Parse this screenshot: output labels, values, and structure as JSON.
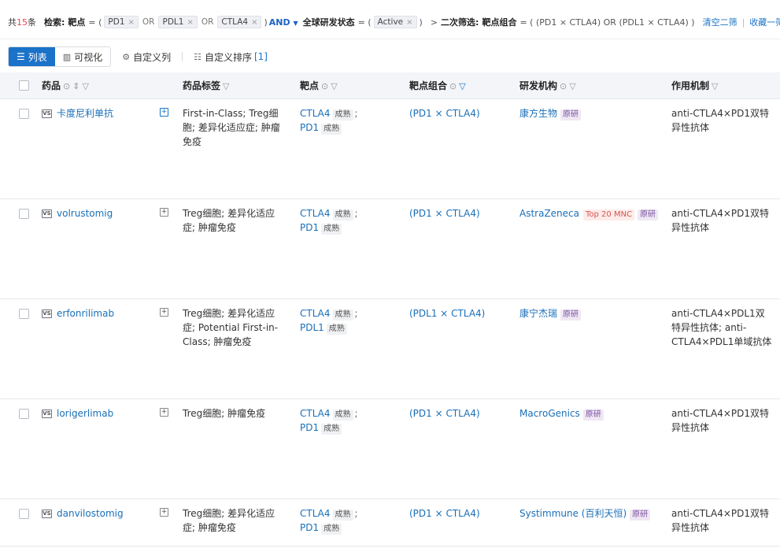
{
  "filter": {
    "total_prefix": "共",
    "total_count": "15",
    "total_suffix": "条",
    "search_label": "检索:",
    "target_label": "靶点",
    "eq_open": "= (",
    "tags1": [
      "PD1",
      "PDL1",
      "CTLA4"
    ],
    "or": "OR",
    "close": ")",
    "and": "AND",
    "status_label": "全球研发状态",
    "status_eq": "= (",
    "status_tag": "Active",
    "second_label": "二次筛选:",
    "combo_label": "靶点组合",
    "combo_expr": "= ( (PD1 × CTLA4) OR (PDL1 × CTLA4) )",
    "clear_link": "清空二筛",
    "save_link": "收藏一筛",
    "divider": "|",
    "arrow": ">"
  },
  "toolbar": {
    "list_label": "列表",
    "chart_label": "可视化",
    "custom_cols": "自定义列",
    "custom_sort": "自定义排序",
    "sort_count": "[1]"
  },
  "table": {
    "headers": {
      "drug": "药品",
      "tags": "药品标签",
      "target": "靶点",
      "combo": "靶点组合",
      "org": "研发机构",
      "moa": "作用机制"
    },
    "mature_label": "成熟",
    "orig_label": "原研",
    "semicolon": ";",
    "rows": [
      {
        "name": "卡度尼利单抗",
        "tags": "First-in-Class; Treg细胞; 差异化适应症; 肿瘤免疫",
        "targets": [
          "CTLA4",
          "PD1"
        ],
        "combo": "(PD1 × CTLA4)",
        "org": "康方生物",
        "mnc": "",
        "moa": "anti-CTLA4×PD1双特异性抗体"
      },
      {
        "name": "volrustomig",
        "tags": "Treg细胞; 差异化适应症; 肿瘤免疫",
        "targets": [
          "CTLA4",
          "PD1"
        ],
        "combo": "(PD1 × CTLA4)",
        "org": "AstraZeneca",
        "mnc": "Top 20 MNC",
        "moa": "anti-CTLA4×PD1双特异性抗体"
      },
      {
        "name": "erfonrilimab",
        "tags": "Treg细胞; 差异化适应症; Potential First-in-Class; 肿瘤免疫",
        "targets": [
          "CTLA4",
          "PDL1"
        ],
        "combo": "(PDL1 × CTLA4)",
        "org": "康宁杰瑞",
        "mnc": "",
        "moa": "anti-CTLA4×PDL1双特异性抗体; anti-CTLA4×PDL1单域抗体"
      },
      {
        "name": "lorigerlimab",
        "tags": "Treg细胞; 肿瘤免疫",
        "targets": [
          "CTLA4",
          "PD1"
        ],
        "combo": "(PD1 × CTLA4)",
        "org": "MacroGenics",
        "mnc": "",
        "moa": "anti-CTLA4×PD1双特异性抗体"
      },
      {
        "name": "danvilostomig",
        "tags": "Treg细胞; 差异化适应症; 肿瘤免疫",
        "targets": [
          "CTLA4",
          "PD1"
        ],
        "combo": "(PD1 × CTLA4)",
        "org": "Systimmune (百利天恒)",
        "mnc": "",
        "moa": "anti-CTLA4×PD1双特异性抗体"
      }
    ]
  },
  "colors": {
    "accent": "#1b72c9",
    "link": "#1a6fb8",
    "orig_bg": "#efe8f4",
    "mnc_text": "#d9534f"
  },
  "icons": {
    "list": "list-icon",
    "chart": "bar-chart-icon",
    "columns": "settings-icon",
    "sort": "sort-icon",
    "filter": "filter-icon",
    "help": "help-circle-icon"
  }
}
